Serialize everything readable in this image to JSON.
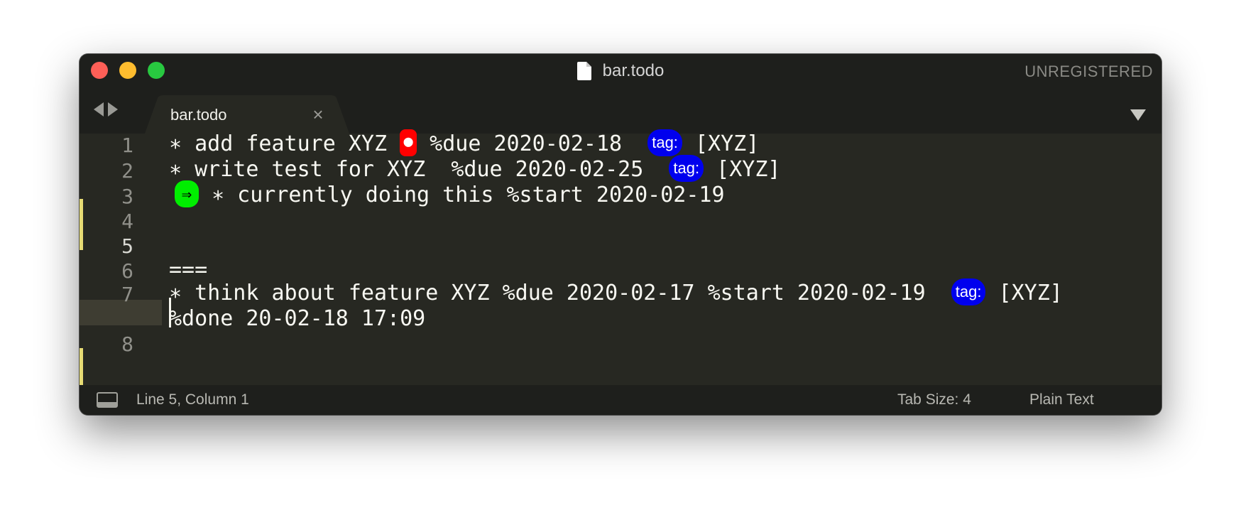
{
  "window": {
    "title": "bar.todo",
    "unregistered": "UNREGISTERED"
  },
  "tab": {
    "label": "bar.todo",
    "close_glyph": "×"
  },
  "editor": {
    "line_numbers": [
      "1",
      "2",
      "3",
      "4",
      "5",
      "6",
      "7",
      "",
      "8"
    ],
    "lines": {
      "l1": {
        "pre": "∗ add feature XYZ ",
        "badge": "●",
        "mid": " %due 2020-02-18  ",
        "tag": "tag:",
        "post": " [XYZ]"
      },
      "l2": {
        "pre": "∗ write test for XYZ  %due 2020-02-25  ",
        "tag": "tag:",
        "post": " [XYZ]"
      },
      "l3": {
        "badge": "⇒",
        "post": " ∗ currently doing this %start 2020-02-19"
      },
      "l6": {
        "text": "==="
      },
      "l7": {
        "pre": "∗ think about feature XYZ %due 2020-02-17 %start 2020-02-19  ",
        "tag": "tag:",
        "post": " [XYZ]"
      },
      "l7b": {
        "text": "%done 20-02-18 17:09"
      }
    }
  },
  "status": {
    "position": "Line 5, Column 1",
    "tab_size": "Tab Size: 4",
    "syntax": "Plain Text"
  },
  "colors": {
    "background": "#272822",
    "tag_badge": "#0000ee",
    "due_badge": "#ff0000",
    "start_badge": "#00ee00",
    "modified_marker": "#e6db74"
  }
}
